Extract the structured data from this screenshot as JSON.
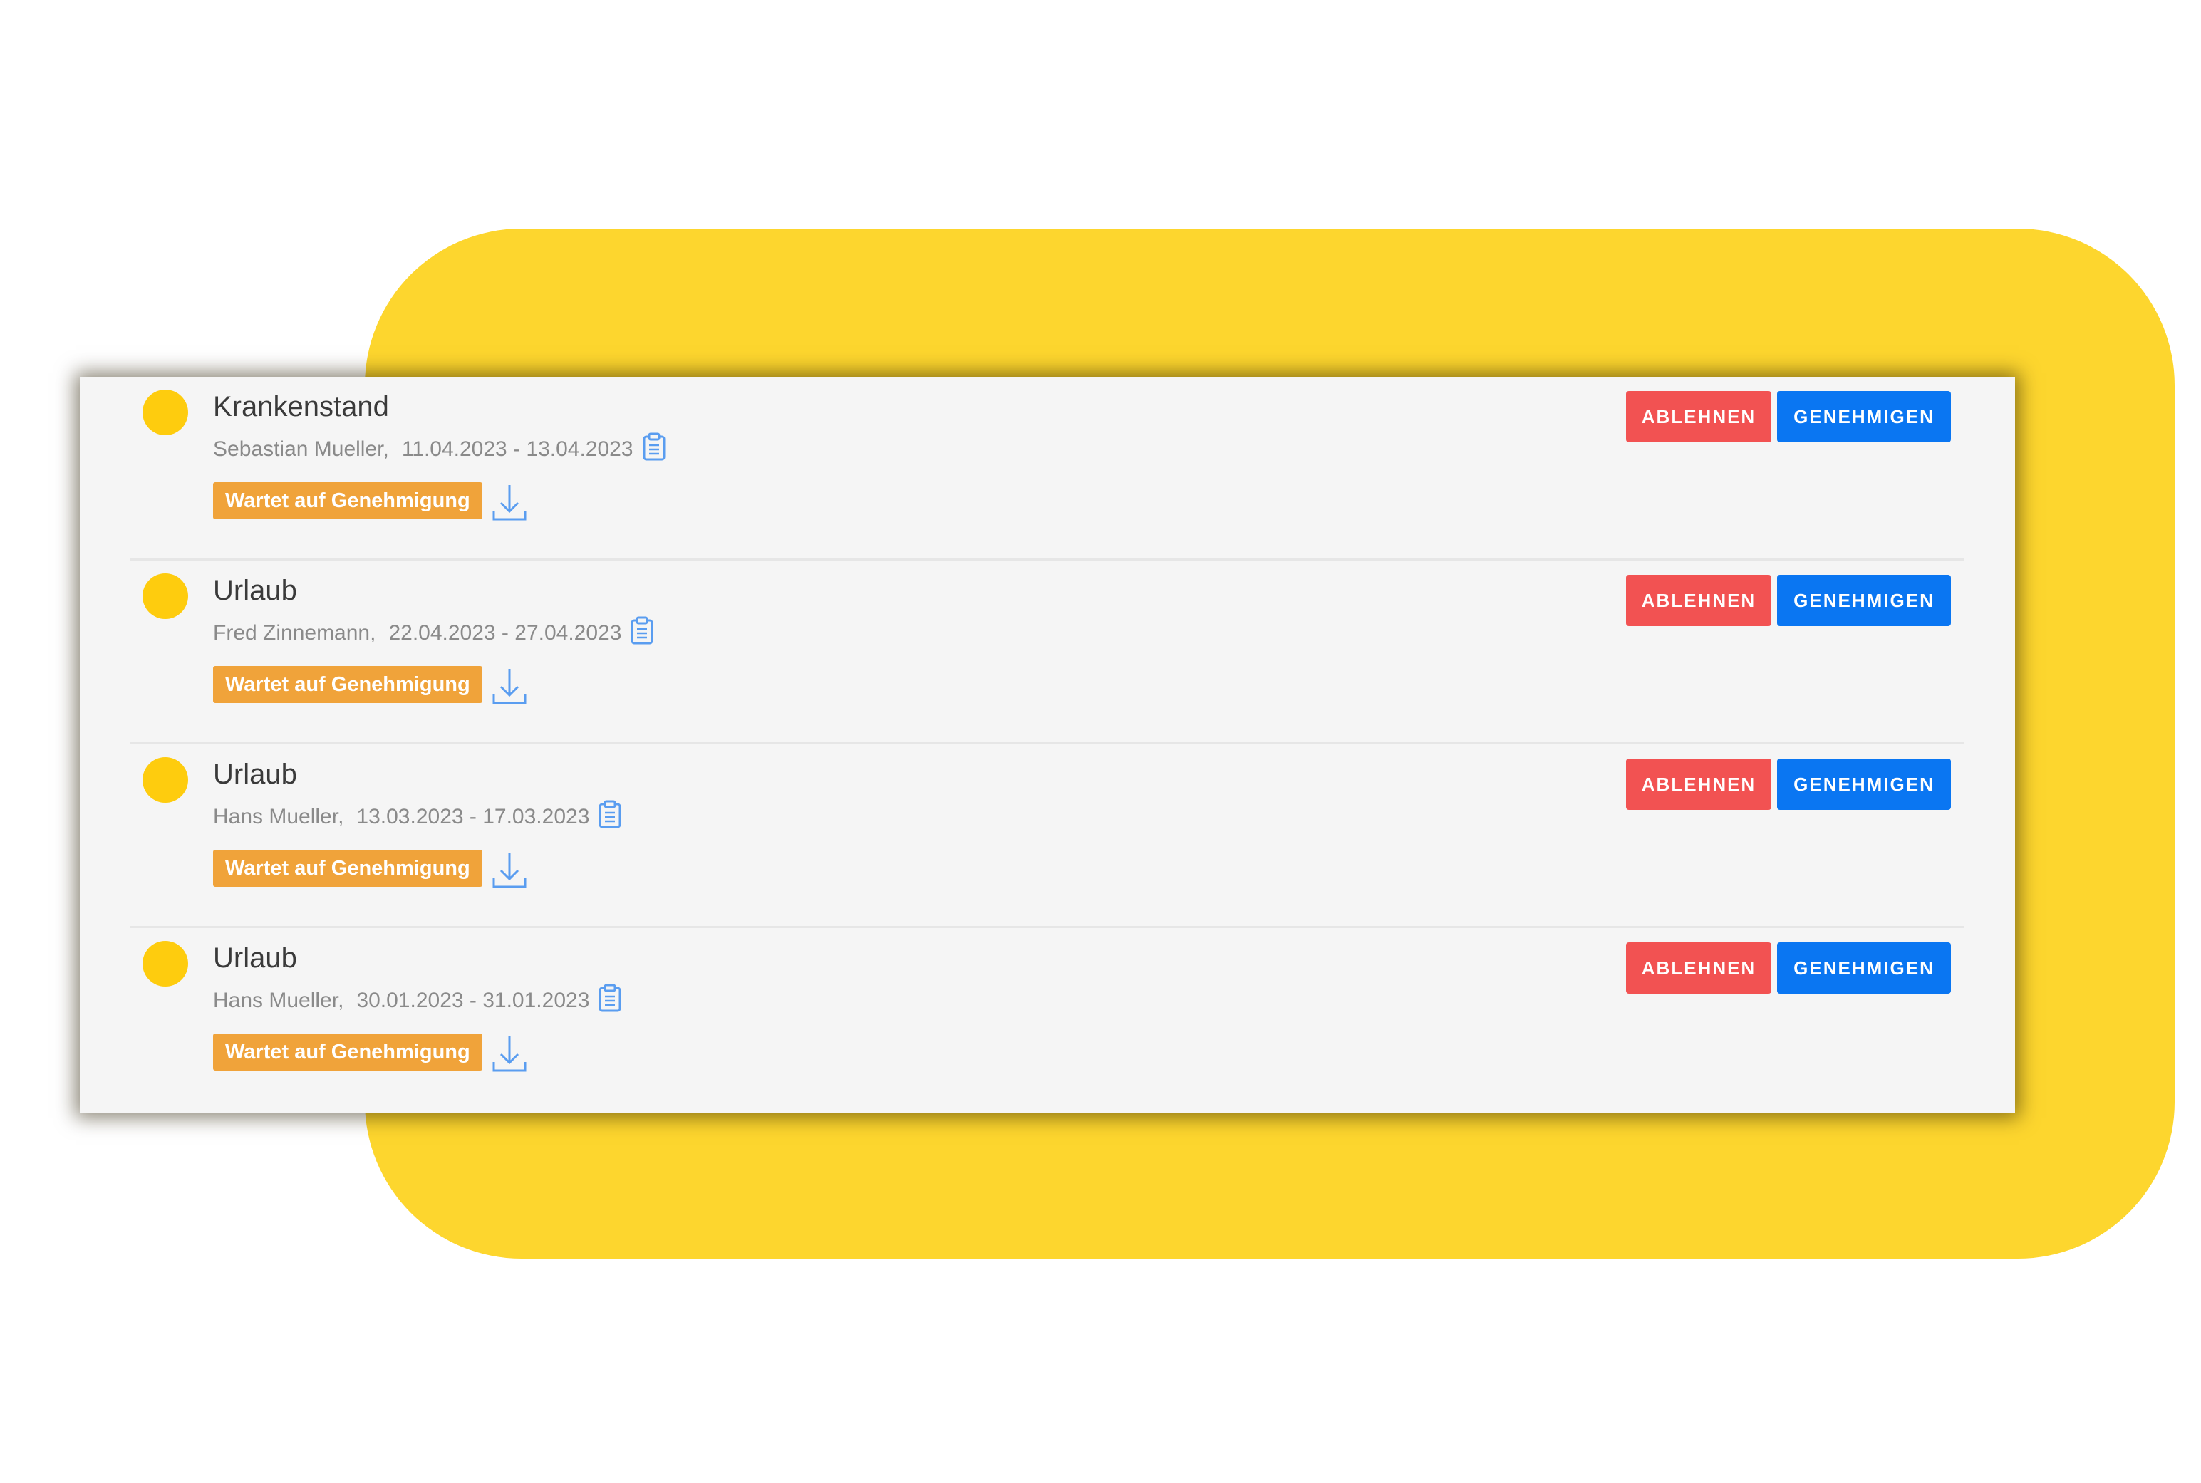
{
  "colors": {
    "backdrop": "#fdd62e",
    "panel": "#f5f5f5",
    "status_dot": "#fecc0e",
    "badge": "#f0a33a",
    "reject": "#f25252",
    "approve": "#0a76f2",
    "icon": "#5a9df0"
  },
  "icons": {
    "clipboard": "clipboard-icon",
    "download": "download-icon",
    "status": "status-dot"
  },
  "requests": [
    {
      "title": "Krankenstand",
      "name": "Sebastian Mueller,",
      "dates": "11.04.2023 - 13.04.2023",
      "status": "Wartet auf Genehmigung",
      "reject_label": "ABLEHNEN",
      "approve_label": "GENEHMIGEN"
    },
    {
      "title": "Urlaub",
      "name": "Fred Zinnemann,",
      "dates": "22.04.2023 - 27.04.2023",
      "status": "Wartet auf Genehmigung",
      "reject_label": "ABLEHNEN",
      "approve_label": "GENEHMIGEN"
    },
    {
      "title": "Urlaub",
      "name": "Hans Mueller,",
      "dates": "13.03.2023 - 17.03.2023",
      "status": "Wartet auf Genehmigung",
      "reject_label": "ABLEHNEN",
      "approve_label": "GENEHMIGEN"
    },
    {
      "title": "Urlaub",
      "name": "Hans Mueller,",
      "dates": "30.01.2023 - 31.01.2023",
      "status": "Wartet auf Genehmigung",
      "reject_label": "ABLEHNEN",
      "approve_label": "GENEHMIGEN"
    }
  ]
}
